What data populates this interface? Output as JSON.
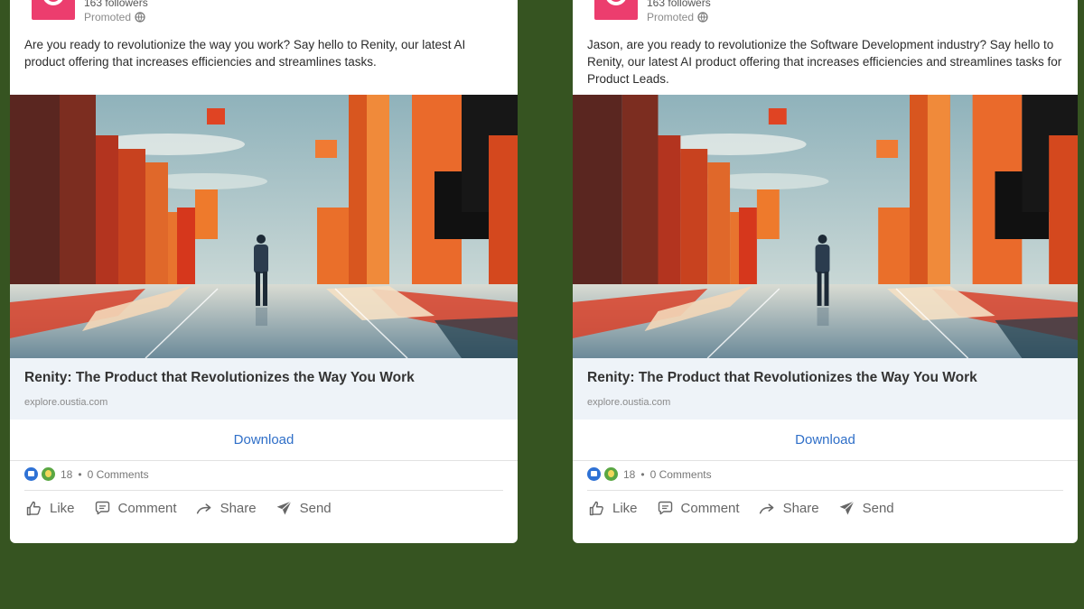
{
  "colors": {
    "background": "#365421",
    "brand": "#ec3d6e",
    "cta": "#2f6fc8",
    "like_reaction": "#2f72d5",
    "celebrate_reaction": "#5aa743"
  },
  "cards": [
    {
      "followers": "163 followers",
      "promoted": "Promoted",
      "text": "Are you ready to revolutionize the way you work? Say hello to Renity, our latest AI product offering that increases efficiencies and streamlines tasks.",
      "link_title": "Renity: The Product that Revolutionizes the Way You Work",
      "link_domain": "explore.oustia.com",
      "cta": "Download",
      "reaction_count": "18",
      "comments": "0 Comments",
      "actions": {
        "like": "Like",
        "comment": "Comment",
        "share": "Share",
        "send": "Send"
      }
    },
    {
      "followers": "163 followers",
      "promoted": "Promoted",
      "text": "Jason, are you ready to revolutionize the Software Development industry? Say hello to Renity, our latest AI product offering that increases efficiencies and streamlines tasks for Product Leads.",
      "link_title": "Renity: The Product that Revolutionizes the Way You Work",
      "link_domain": "explore.oustia.com",
      "cta": "Download",
      "reaction_count": "18",
      "comments": "0 Comments",
      "actions": {
        "like": "Like",
        "comment": "Comment",
        "share": "Share",
        "send": "Send"
      }
    }
  ],
  "icons": [
    "brand-logo-icon",
    "globe-icon",
    "like-reaction-icon",
    "celebrate-reaction-icon",
    "thumbs-up-icon",
    "comment-icon",
    "share-arrow-icon",
    "send-icon"
  ]
}
